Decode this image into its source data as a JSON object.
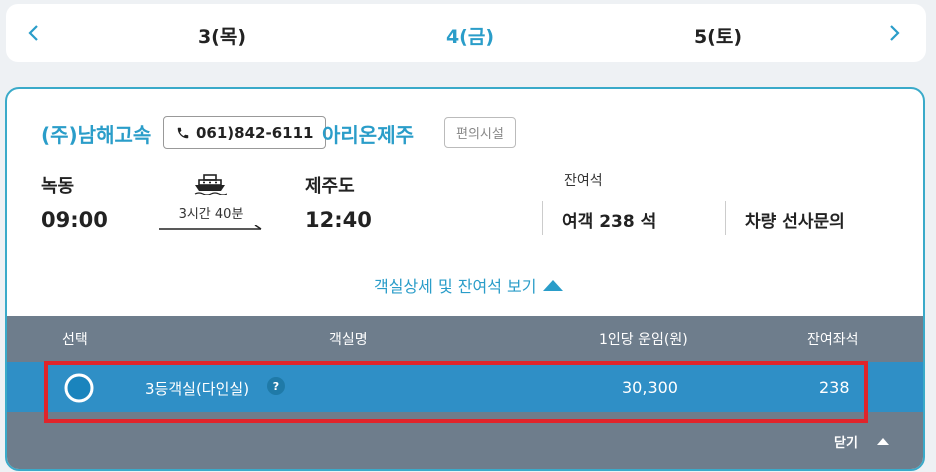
{
  "dates": {
    "prev": "3(목)",
    "current": "4(금)",
    "next": "5(토)"
  },
  "route": {
    "operator": "(주)남해고속",
    "phone": "061)842-6111",
    "ship_name": "아리온제주",
    "facility_label": "편의시설",
    "departure_port": "녹동",
    "departure_time": "09:00",
    "duration": "3시간 40분",
    "arrival_port": "제주도",
    "arrival_time": "12:40",
    "remaining_label": "잔여석",
    "remaining_passenger": "여객 238 석",
    "remaining_vehicle": "차량 선사문의",
    "detail_toggle": "객실상세 및 잔여석 보기"
  },
  "cabin_table": {
    "headers": [
      "선택",
      "객실명",
      "1인당 운임(원)",
      "잔여좌석"
    ],
    "rows": [
      {
        "name": "3등객실(다인실)",
        "help": "?",
        "fare": "30,300",
        "seats": "238"
      }
    ],
    "close_label": "닫기"
  },
  "colors": {
    "accent": "#2a9dc9",
    "selected_row": "#2f8fc6",
    "table_bg": "#6e7d8c",
    "highlight": "#e0242b"
  }
}
